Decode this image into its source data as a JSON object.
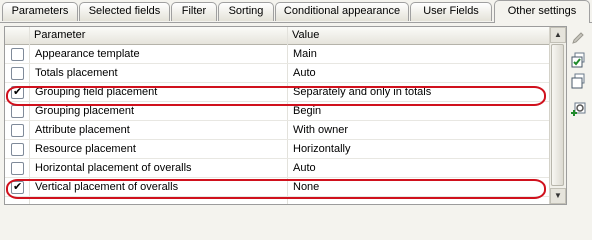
{
  "tabs": [
    {
      "label": "Parameters"
    },
    {
      "label": "Selected fields"
    },
    {
      "label": "Filter"
    },
    {
      "label": "Sorting"
    },
    {
      "label": "Conditional appearance"
    },
    {
      "label": "User Fields"
    },
    {
      "label": "Other settings",
      "active": true
    }
  ],
  "table": {
    "col_parameter": "Parameter",
    "col_value": "Value",
    "rows": [
      {
        "checked": false,
        "parameter": "Appearance template",
        "value": "Main",
        "highlighted": false
      },
      {
        "checked": false,
        "parameter": "Totals placement",
        "value": "Auto",
        "highlighted": false
      },
      {
        "checked": true,
        "parameter": "Grouping field placement",
        "value": "Separately and only in totals",
        "highlighted": true
      },
      {
        "checked": false,
        "parameter": "Grouping placement",
        "value": "Begin",
        "highlighted": false
      },
      {
        "checked": false,
        "parameter": "Attribute placement",
        "value": "With owner",
        "highlighted": false
      },
      {
        "checked": false,
        "parameter": "Resource placement",
        "value": "Horizontally",
        "highlighted": false
      },
      {
        "checked": false,
        "parameter": "Horizontal placement of overalls",
        "value": "Auto",
        "highlighted": false
      },
      {
        "checked": true,
        "parameter": "Vertical placement of overalls",
        "value": "None",
        "highlighted": true
      }
    ]
  },
  "toolbar": [
    "pencil-icon",
    "check-all-icon",
    "uncheck-all-icon",
    "add-settings-icon"
  ],
  "colors": {
    "highlight": "#d0111d",
    "background": "#f4f3ee",
    "grid_border": "#9c9c9c"
  }
}
